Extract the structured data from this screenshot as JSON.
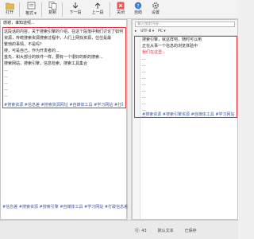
{
  "toolbar": {
    "buttons": [
      {
        "label": "打开",
        "icon": "folder-icon"
      },
      {
        "label": "格式",
        "icon": "format-icon"
      },
      {
        "label": "复制",
        "icon": "copy-icon"
      },
      {
        "label": "下一段",
        "icon": "next-icon"
      },
      {
        "label": "上一段",
        "icon": "prev-icon"
      },
      {
        "label": "关闭",
        "icon": "close-icon"
      },
      {
        "label": "自助",
        "icon": "help-icon"
      },
      {
        "label": "设置",
        "icon": "gear-icon"
      }
    ]
  },
  "left": {
    "lines": [
      "感谢，谁知道呢...",
      "这段话的内容，关于搜索引擎的介绍，在这个段落中我们讨论了如何搜索",
      "资源，传统搜索资源搜索过程中，人们上网找资源，往往是最",
      "繁琐的事情，不是吗？",
      "",
      "搜，可是自己，作为开发者的...",
      "首先，和大部分的软件一样，要有一个很好的新的搜索...",
      "搜索网站，搜索引擎，信息检索，搜索工具集合",
      "...",
      "...",
      "...",
      "...",
      "..."
    ],
    "tagline": "#搜索资源 #信息差 #搜索资源网址 #自媒体工具 #学习网站 #打破信息差",
    "bottom_line": "#信息差 #搜索资源 #搜索引擎 #自媒体工具 #学习网站 #打破信息差 #网盘搜索"
  },
  "right": {
    "search_placeholder": "输入搜索内容...",
    "encoding": "UTF-8",
    "platform": "PC",
    "lines": [
      "搜索引擎，就这样吧，随时可以用",
      "正在从事一个信息的浏览体验中",
      "...",
      "...",
      "...",
      "...",
      "...",
      "...",
      "...",
      "...",
      "...",
      "...",
      "..."
    ],
    "red_line": "我们在这里...",
    "tagline": "#搜索资源 #搜索引擎资源 #自媒体工具 #学习网站"
  },
  "status": {
    "line": "行: 43",
    "encoding": "默认文本",
    "state": "已保存"
  }
}
